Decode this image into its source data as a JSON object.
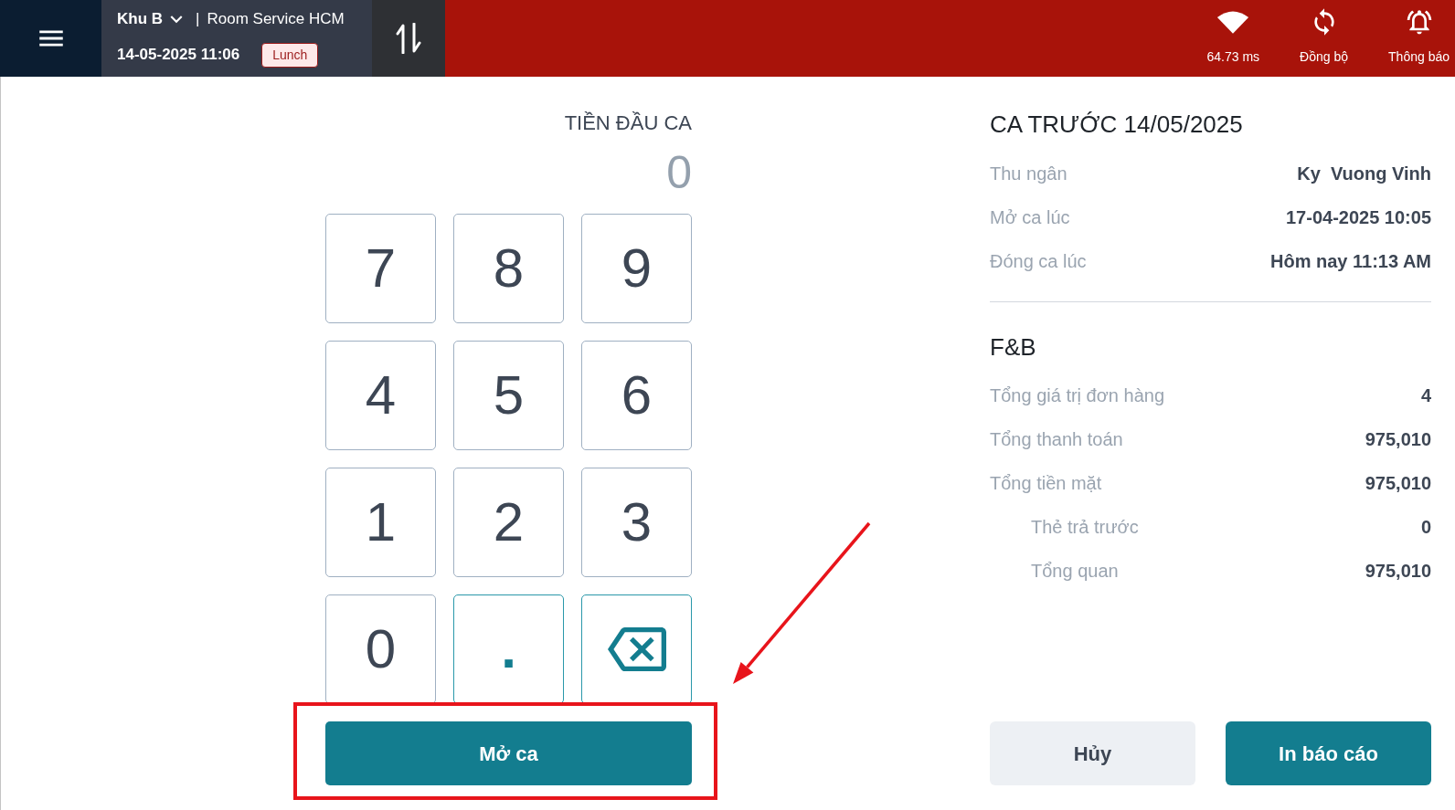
{
  "header": {
    "area": "Khu B",
    "separator": "|",
    "outlet": "Room Service HCM",
    "datetime": "14-05-2025 11:06",
    "meal_period": "Lunch",
    "status_items": [
      {
        "kind": "network",
        "label": "64.73 ms"
      },
      {
        "kind": "sync",
        "label": "Đồng bộ"
      },
      {
        "kind": "notifications",
        "label": "Thông báo"
      }
    ]
  },
  "opening_cash": {
    "title": "TIỀN ĐẦU CA",
    "amount": "0"
  },
  "keypad": [
    {
      "kind": "digit",
      "label": "7"
    },
    {
      "kind": "digit",
      "label": "8"
    },
    {
      "kind": "digit",
      "label": "9"
    },
    {
      "kind": "digit",
      "label": "4"
    },
    {
      "kind": "digit",
      "label": "5"
    },
    {
      "kind": "digit",
      "label": "6"
    },
    {
      "kind": "digit",
      "label": "1"
    },
    {
      "kind": "digit",
      "label": "2"
    },
    {
      "kind": "digit",
      "label": "3"
    },
    {
      "kind": "digit",
      "label": "0"
    },
    {
      "kind": "decimal",
      "label": "."
    },
    {
      "kind": "backspace"
    }
  ],
  "open_shift_button": {
    "label": "Mở ca"
  },
  "previous_shift": {
    "title": "CA TRƯỚC 14/05/2025",
    "rows": [
      {
        "label": "Thu ngân",
        "value": "Ky  Vuong Vinh"
      },
      {
        "label": "Mở ca lúc",
        "value": "17-04-2025 10:05"
      },
      {
        "label": "Đóng ca lúc",
        "value": "Hôm nay 11:13 AM"
      }
    ]
  },
  "fnb": {
    "title": "F&B",
    "rows": [
      {
        "label": "Tổng giá trị đơn hàng",
        "value": "4"
      },
      {
        "label": "Tổng thanh toán",
        "value": "975,010"
      },
      {
        "label": "Tổng tiền mặt",
        "value": "975,010",
        "children": [
          {
            "label": "Thẻ trả trước",
            "value": "0"
          },
          {
            "label": "Tổng quan",
            "value": "975,010"
          }
        ]
      }
    ]
  },
  "actions": [
    {
      "kind": "secondary",
      "label": "Hủy"
    },
    {
      "kind": "primary",
      "label": "In báo cáo"
    }
  ]
}
